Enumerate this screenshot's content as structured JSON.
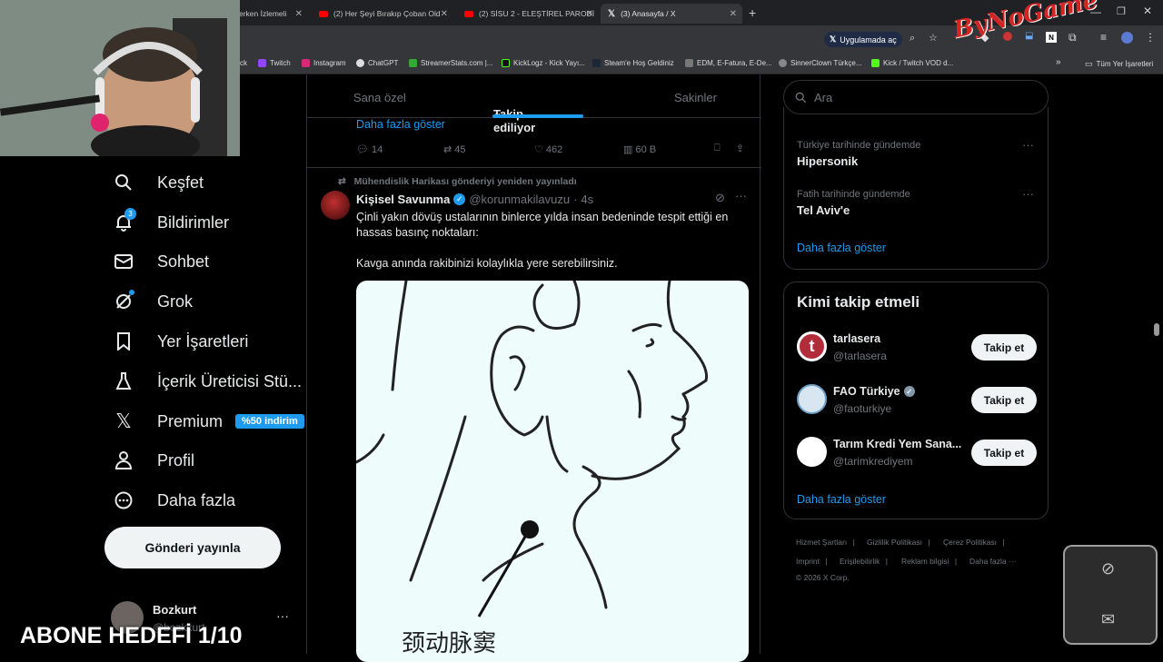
{
  "browser": {
    "tabs": [
      {
        "label": "erken İzlemeli"
      },
      {
        "label": "(2) Her Şeyi Bırakıp Çoban Old"
      },
      {
        "label": "(2) SİSU 2 - ELEŞTİREL PARODİ"
      },
      {
        "label": "(3) Anasayfa / X"
      }
    ],
    "open_in_app": "Uygulamada aç",
    "bookmarks": [
      "ck",
      "Twitch",
      "Instagram",
      "ChatGPT",
      "StreamerStats.com |...",
      "KickLogz - Kick Yayı...",
      "Steam'e Hoş Geldiniz",
      "EDM, E-Fatura, E-De...",
      "SinnerClown Türkçe...",
      "Kick / Twitch VOD d..."
    ],
    "all_bookmarks": "Tüm Yer İşaretleri",
    "overlay_logo": "ByNoGame"
  },
  "sidebar": {
    "items": [
      {
        "label": "Keşfet",
        "icon": "search-icon"
      },
      {
        "label": "Bildirimler",
        "icon": "bell-icon",
        "badge": "3"
      },
      {
        "label": "Sohbet",
        "icon": "mail-icon"
      },
      {
        "label": "Grok",
        "icon": "grok-icon"
      },
      {
        "label": "Yer İşaretleri",
        "icon": "bookmark-icon"
      },
      {
        "label": "İçerik Üreticisi Stü...",
        "icon": "flask-icon"
      },
      {
        "label": "Premium",
        "icon": "x-logo-icon",
        "badge": "%50 indirim"
      },
      {
        "label": "Profil",
        "icon": "person-icon"
      },
      {
        "label": "Daha fazla",
        "icon": "more-circle-icon"
      }
    ],
    "post_button": "Gönderi yayınla",
    "account": {
      "name": "Bozkurt",
      "handle": "@bozkkurt"
    }
  },
  "overlay": {
    "subscribe_goal": "ABONE HEDEFİ 1/10"
  },
  "timeline": {
    "tabs": [
      "Sana özel",
      "Takip ediliyor",
      "Sakinler"
    ],
    "prev_show_more": "Daha fazla göster",
    "prev_actions": {
      "replies": "14",
      "reposts": "45",
      "likes": "462",
      "views": "60 B"
    },
    "repost_label": "Mühendislik Harikası gönderiyi yeniden yayınladı",
    "author": "Kişisel Savunma",
    "handle": "@korunmakilavuzu",
    "time": "4s",
    "text_line1": "Çinli yakın dövüş ustalarının binlerce yılda insan bedeninde tespit ettiği en",
    "text_line2": "hassas basınç noktaları:",
    "text_line3": "Kavga anında rakibinizi kolaylıkla yere serebilirsiniz.",
    "image_caption": "颈动脉窦"
  },
  "right": {
    "search_placeholder": "Ara",
    "trends": [
      {
        "context": "Türkiye tarihinde gündemde",
        "name": "Hipersonik"
      },
      {
        "context": "Fatih tarihinde gündemde",
        "name": "Tel Aviv'e"
      }
    ],
    "trends_more": "Daha fazla göster",
    "who_title": "Kimi takip etmeli",
    "who": [
      {
        "name": "tarlasera",
        "handle": "@tarlasera",
        "button": "Takip et"
      },
      {
        "name": "FAO Türkiye",
        "handle": "@faoturkiye",
        "button": "Takip et"
      },
      {
        "name": "Tarım Kredi Yem Sana...",
        "handle": "@tarimkrediyem",
        "button": "Takip et"
      }
    ],
    "who_more": "Daha fazla göster",
    "footer": [
      "Hizmet Şartları",
      "Gizlilik Politikası",
      "Çerez Politikası",
      "Imprint",
      "Erişilebilirlik",
      "Reklam bilgisi",
      "Daha fazla ···"
    ],
    "copyright": "© 2026 X Corp."
  }
}
